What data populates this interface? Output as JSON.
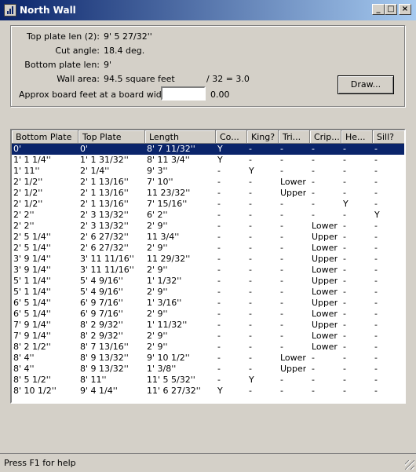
{
  "window": {
    "title": "North Wall",
    "controls": [
      "_",
      "□",
      "×"
    ]
  },
  "form": {
    "top_plate_len_label": "Top plate len (2):",
    "top_plate_len_value": "9' 5 27/32''",
    "cut_angle_label": "Cut angle:",
    "cut_angle_value": "18.4 deg.",
    "bottom_plate_len_label": "Bottom plate len:",
    "bottom_plate_len_value": "9'",
    "wall_area_label": "Wall area:",
    "wall_area_value": "94.5 square feet",
    "wall_area_calc": "/ 32  =  3.0",
    "board_feet_label": "Approx board feet at a board width of:",
    "board_width_value": "",
    "board_feet_result": "0.00",
    "draw_button": "Draw..."
  },
  "table": {
    "columns": [
      "Bottom Plate",
      "Top Plate",
      "Length",
      "Co...",
      "King?",
      "Tri...",
      "Crip...",
      "He...",
      "Sill?"
    ],
    "rows": [
      [
        "0'",
        "0'",
        "8' 7 11/32''",
        "Y",
        "-",
        "-",
        "-",
        "-",
        "-"
      ],
      [
        "1' 1 1/4''",
        "1' 1 31/32''",
        "8' 11 3/4''",
        "Y",
        "-",
        "-",
        "-",
        "-",
        "-"
      ],
      [
        "1' 11''",
        "2' 1/4''",
        "9' 3''",
        "-",
        "Y",
        "-",
        "-",
        "-",
        "-"
      ],
      [
        "2' 1/2''",
        "2' 1 13/16''",
        "7' 10''",
        "-",
        "-",
        "Lower",
        "-",
        "-",
        "-"
      ],
      [
        "2' 1/2''",
        "2' 1 13/16''",
        "11 23/32''",
        "-",
        "-",
        "Upper",
        "-",
        "-",
        "-"
      ],
      [
        "2' 1/2''",
        "2' 1 13/16''",
        "7' 15/16''",
        "-",
        "-",
        "-",
        "-",
        "Y",
        "-"
      ],
      [
        "2' 2''",
        "2' 3 13/32''",
        "6' 2''",
        "-",
        "-",
        "-",
        "-",
        "-",
        "Y"
      ],
      [
        "2' 2''",
        "2' 3 13/32''",
        "2' 9''",
        "-",
        "-",
        "-",
        "Lower",
        "-",
        "-"
      ],
      [
        "2' 5 1/4''",
        "2' 6 27/32''",
        "11 3/4''",
        "-",
        "-",
        "-",
        "Upper",
        "-",
        "-"
      ],
      [
        "2' 5 1/4''",
        "2' 6 27/32''",
        "2' 9''",
        "-",
        "-",
        "-",
        "Lower",
        "-",
        "-"
      ],
      [
        "3' 9 1/4''",
        "3' 11 11/16''",
        "11 29/32''",
        "-",
        "-",
        "-",
        "Upper",
        "-",
        "-"
      ],
      [
        "3' 9 1/4''",
        "3' 11 11/16''",
        "2' 9''",
        "-",
        "-",
        "-",
        "Lower",
        "-",
        "-"
      ],
      [
        "5' 1 1/4''",
        "5' 4 9/16''",
        "1' 1/32''",
        "-",
        "-",
        "-",
        "Upper",
        "-",
        "-"
      ],
      [
        "5' 1 1/4''",
        "5' 4 9/16''",
        "2' 9''",
        "-",
        "-",
        "-",
        "Lower",
        "-",
        "-"
      ],
      [
        "6' 5 1/4''",
        "6' 9 7/16''",
        "1' 3/16''",
        "-",
        "-",
        "-",
        "Upper",
        "-",
        "-"
      ],
      [
        "6' 5 1/4''",
        "6' 9 7/16''",
        "2' 9''",
        "-",
        "-",
        "-",
        "Lower",
        "-",
        "-"
      ],
      [
        "7' 9 1/4''",
        "8' 2 9/32''",
        "1' 11/32''",
        "-",
        "-",
        "-",
        "Upper",
        "-",
        "-"
      ],
      [
        "7' 9 1/4''",
        "8' 2 9/32''",
        "2' 9''",
        "-",
        "-",
        "-",
        "Lower",
        "-",
        "-"
      ],
      [
        "8' 2 1/2''",
        "8' 7 13/16''",
        "2' 9''",
        "-",
        "-",
        "-",
        "Lower",
        "-",
        "-"
      ],
      [
        "8' 4''",
        "8' 9 13/32''",
        "9' 10 1/2''",
        "-",
        "-",
        "Lower",
        "-",
        "-",
        "-"
      ],
      [
        "8' 4''",
        "8' 9 13/32''",
        "1' 3/8''",
        "-",
        "-",
        "Upper",
        "-",
        "-",
        "-"
      ],
      [
        "8' 5 1/2''",
        "8' 11''",
        "11' 5 5/32''",
        "-",
        "Y",
        "-",
        "-",
        "-",
        "-"
      ],
      [
        "8' 10 1/2''",
        "9' 4 1/4''",
        "11' 6 27/32''",
        "Y",
        "-",
        "-",
        "-",
        "-",
        "-"
      ]
    ],
    "selected_row": 0
  },
  "status": {
    "text": "Press F1 for help"
  },
  "colors": {
    "titlebar_start": "#0a246a",
    "titlebar_end": "#a6caf0",
    "selection": "#0a246a",
    "face": "#d4d0c8"
  }
}
